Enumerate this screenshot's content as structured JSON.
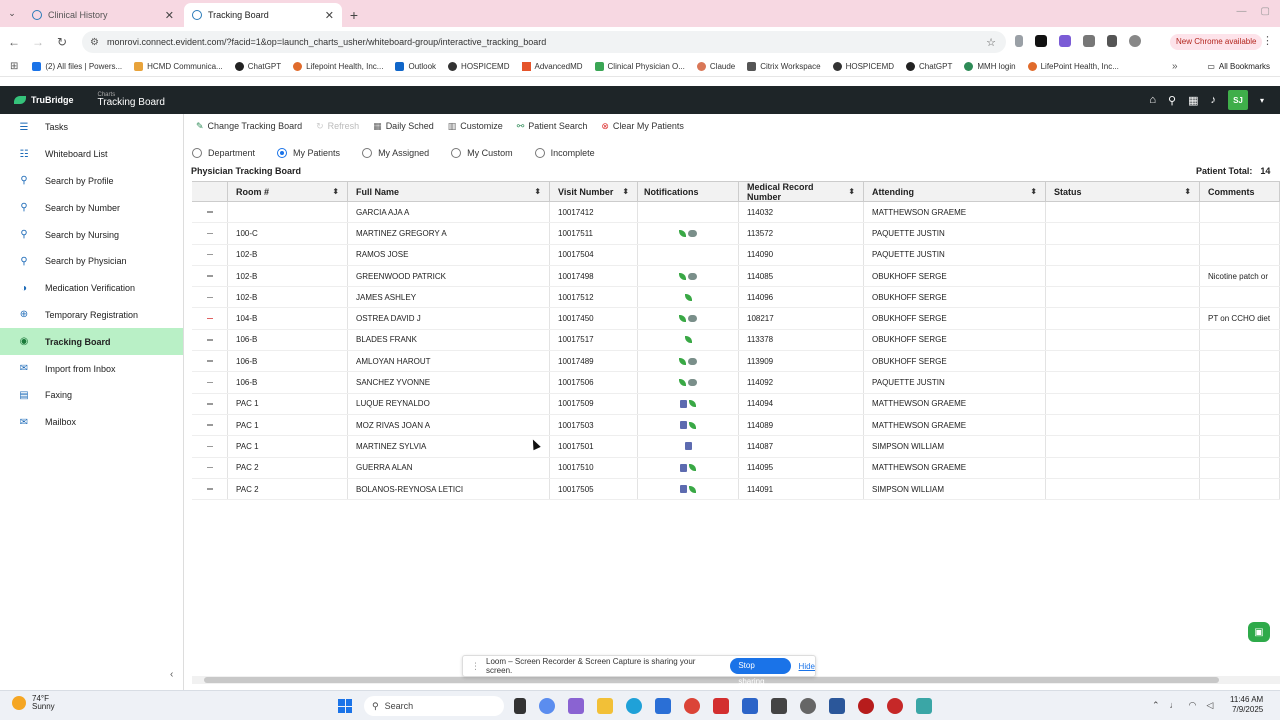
{
  "browser": {
    "tabs": [
      {
        "label": "Clinical History",
        "active": false
      },
      {
        "label": "Tracking Board",
        "active": true
      }
    ],
    "url": "monrovi.connect.evident.com/?facid=1&op=launch_charts_usher/whiteboard-group/interactive_tracking_board",
    "new_chrome_label": "New Chrome available",
    "bookmarks": [
      {
        "label": "(2) All files | Powers..."
      },
      {
        "label": "HCMD Communica..."
      },
      {
        "label": "ChatGPT"
      },
      {
        "label": "Lifepoint Health, Inc..."
      },
      {
        "label": "Outlook"
      },
      {
        "label": "HOSPICEMD"
      },
      {
        "label": "AdvancedMD"
      },
      {
        "label": "Clinical Physician O..."
      },
      {
        "label": "Claude"
      },
      {
        "label": "Citrix Workspace"
      },
      {
        "label": "HOSPICEMD"
      },
      {
        "label": "ChatGPT"
      },
      {
        "label": "MMH login"
      },
      {
        "label": "LifePoint Health, Inc..."
      }
    ],
    "all_bookmarks_label": "All Bookmarks"
  },
  "app": {
    "brand": "TruBridge",
    "module_sup": "Charts",
    "module": "Tracking Board",
    "user_initials": "SJ"
  },
  "sidebar": {
    "items": [
      {
        "label": "Tasks",
        "icon": "tasks-icon"
      },
      {
        "label": "Whiteboard List",
        "icon": "list-icon"
      },
      {
        "label": "Search by Profile",
        "icon": "search-icon"
      },
      {
        "label": "Search by Number",
        "icon": "search-icon"
      },
      {
        "label": "Search by Nursing",
        "icon": "search-icon"
      },
      {
        "label": "Search by Physician",
        "icon": "search-icon"
      },
      {
        "label": "Medication Verification",
        "icon": "medication-icon"
      },
      {
        "label": "Temporary Registration",
        "icon": "registration-icon"
      },
      {
        "label": "Tracking Board",
        "icon": "location-icon",
        "active": true
      },
      {
        "label": "Import from Inbox",
        "icon": "mail-icon"
      },
      {
        "label": "Faxing",
        "icon": "fax-icon"
      },
      {
        "label": "Mailbox",
        "icon": "mailbox-icon"
      }
    ]
  },
  "toolbar": {
    "change_board": "Change Tracking Board",
    "refresh": "Refresh",
    "daily_sched": "Daily Sched",
    "customize": "Customize",
    "patient_search": "Patient Search",
    "clear_patients": "Clear My Patients"
  },
  "filters": {
    "options": [
      {
        "label": "Department",
        "checked": false
      },
      {
        "label": "My Patients",
        "checked": true
      },
      {
        "label": "My Assigned",
        "checked": false
      },
      {
        "label": "My Custom",
        "checked": false
      },
      {
        "label": "Incomplete",
        "checked": false
      }
    ]
  },
  "board": {
    "title": "Physician Tracking Board",
    "patient_total_label": "Patient Total:",
    "patient_total": "14",
    "columns": [
      "Room #",
      "Full Name",
      "Visit Number",
      "Notifications",
      "Medical Record Number",
      "Attending",
      "Status",
      "Comments"
    ],
    "rows": [
      {
        "room": "",
        "name": "GARCIA AJA A",
        "visit": "10017412",
        "notif": [],
        "mrn": "114032",
        "attending": "MATTHEWSON GRAEME",
        "status": "",
        "comments": "",
        "flag": "gray"
      },
      {
        "room": "100-C",
        "name": "MARTINEZ GREGORY A",
        "visit": "10017511",
        "notif": [
          "leaf",
          "chat"
        ],
        "mrn": "113572",
        "attending": "PAQUETTE JUSTIN",
        "status": "",
        "comments": "",
        "flag": "gray"
      },
      {
        "room": "102-B",
        "name": "RAMOS JOSE",
        "visit": "10017504",
        "notif": [],
        "mrn": "114090",
        "attending": "PAQUETTE JUSTIN",
        "status": "",
        "comments": "",
        "flag": "gray"
      },
      {
        "room": "102-B",
        "name": "GREENWOOD PATRICK",
        "visit": "10017498",
        "notif": [
          "leaf",
          "chat"
        ],
        "mrn": "114085",
        "attending": "OBUKHOFF SERGE",
        "status": "",
        "comments": "Nicotine patch or",
        "flag": "gray"
      },
      {
        "room": "102-B",
        "name": "JAMES ASHLEY",
        "visit": "10017512",
        "notif": [
          "leaf"
        ],
        "mrn": "114096",
        "attending": "OBUKHOFF SERGE",
        "status": "",
        "comments": "",
        "flag": "gray"
      },
      {
        "room": "104-B",
        "name": "OSTREA DAVID J",
        "visit": "10017450",
        "notif": [
          "leaf",
          "chat"
        ],
        "mrn": "108217",
        "attending": "OBUKHOFF SERGE",
        "status": "",
        "comments": "PT on CCHO diet",
        "flag": "red"
      },
      {
        "room": "106-B",
        "name": "BLADES FRANK",
        "visit": "10017517",
        "notif": [
          "leaf"
        ],
        "mrn": "113378",
        "attending": "OBUKHOFF SERGE",
        "status": "",
        "comments": "",
        "flag": "gray"
      },
      {
        "room": "106-B",
        "name": "AMLOYAN HAROUT",
        "visit": "10017489",
        "notif": [
          "leaf",
          "chat"
        ],
        "mrn": "113909",
        "attending": "OBUKHOFF SERGE",
        "status": "",
        "comments": "",
        "flag": "gray"
      },
      {
        "room": "106-B",
        "name": "SANCHEZ YVONNE",
        "visit": "10017506",
        "notif": [
          "leaf",
          "chat"
        ],
        "mrn": "114092",
        "attending": "PAQUETTE JUSTIN",
        "status": "",
        "comments": "",
        "flag": "gray"
      },
      {
        "room": "PAC 1",
        "name": "LUQUE REYNALDO",
        "visit": "10017509",
        "notif": [
          "doc",
          "leaf"
        ],
        "mrn": "114094",
        "attending": "MATTHEWSON GRAEME",
        "status": "",
        "comments": "",
        "flag": "gray"
      },
      {
        "room": "PAC 1",
        "name": "MOZ RIVAS JOAN A",
        "visit": "10017503",
        "notif": [
          "doc",
          "leaf"
        ],
        "mrn": "114089",
        "attending": "MATTHEWSON GRAEME",
        "status": "",
        "comments": "",
        "flag": "gray"
      },
      {
        "room": "PAC 1",
        "name": "MARTINEZ SYLVIA",
        "visit": "10017501",
        "notif": [
          "doc"
        ],
        "mrn": "114087",
        "attending": "SIMPSON WILLIAM",
        "status": "",
        "comments": "",
        "flag": "gray"
      },
      {
        "room": "PAC 2",
        "name": "GUERRA ALAN",
        "visit": "10017510",
        "notif": [
          "doc",
          "leaf"
        ],
        "mrn": "114095",
        "attending": "MATTHEWSON GRAEME",
        "status": "",
        "comments": "",
        "flag": "gray"
      },
      {
        "room": "PAC 2",
        "name": "BOLANOS-REYNOSA LETICI",
        "visit": "10017505",
        "notif": [
          "doc",
          "leaf"
        ],
        "mrn": "114091",
        "attending": "SIMPSON WILLIAM",
        "status": "",
        "comments": "",
        "flag": "gray"
      }
    ]
  },
  "share": {
    "text": "Loom – Screen Recorder & Screen Capture is sharing your screen.",
    "stop": "Stop sharing",
    "hide": "Hide"
  },
  "taskbar": {
    "temp": "74°F",
    "weather": "Sunny",
    "search": "Search",
    "time": "11:46 AM",
    "date": "7/9/2025"
  }
}
